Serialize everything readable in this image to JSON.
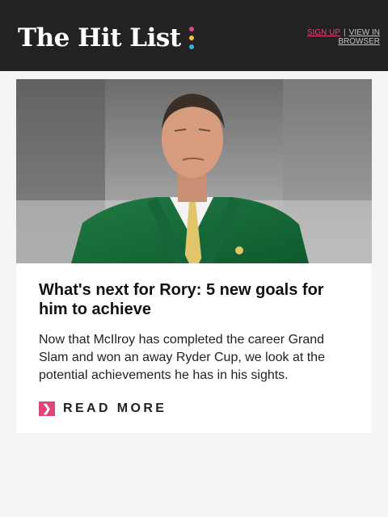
{
  "header": {
    "logo_text": "The Hit List",
    "logo_dot_colors": [
      "#e0457b",
      "#f5c242",
      "#3db0e3"
    ],
    "signup_label": "SIGN UP",
    "separator": "|",
    "view_in_browser_label": "VIEW IN BROWSER",
    "signup_color": "#e0457b",
    "link_color": "#c4c4c4"
  },
  "article": {
    "image_alt": "Rory McIlroy in a green jacket",
    "headline": "What's next for Rory: 5 new goals for him to achieve",
    "summary": "Now that McIlroy has completed the career Grand Slam and won an away Ryder Cup, we look at the potential achievements he has in his sights.",
    "read_more_icon": "chevron-right-icon",
    "read_more_label": "READ MORE",
    "accent_color": "#e0457b"
  }
}
